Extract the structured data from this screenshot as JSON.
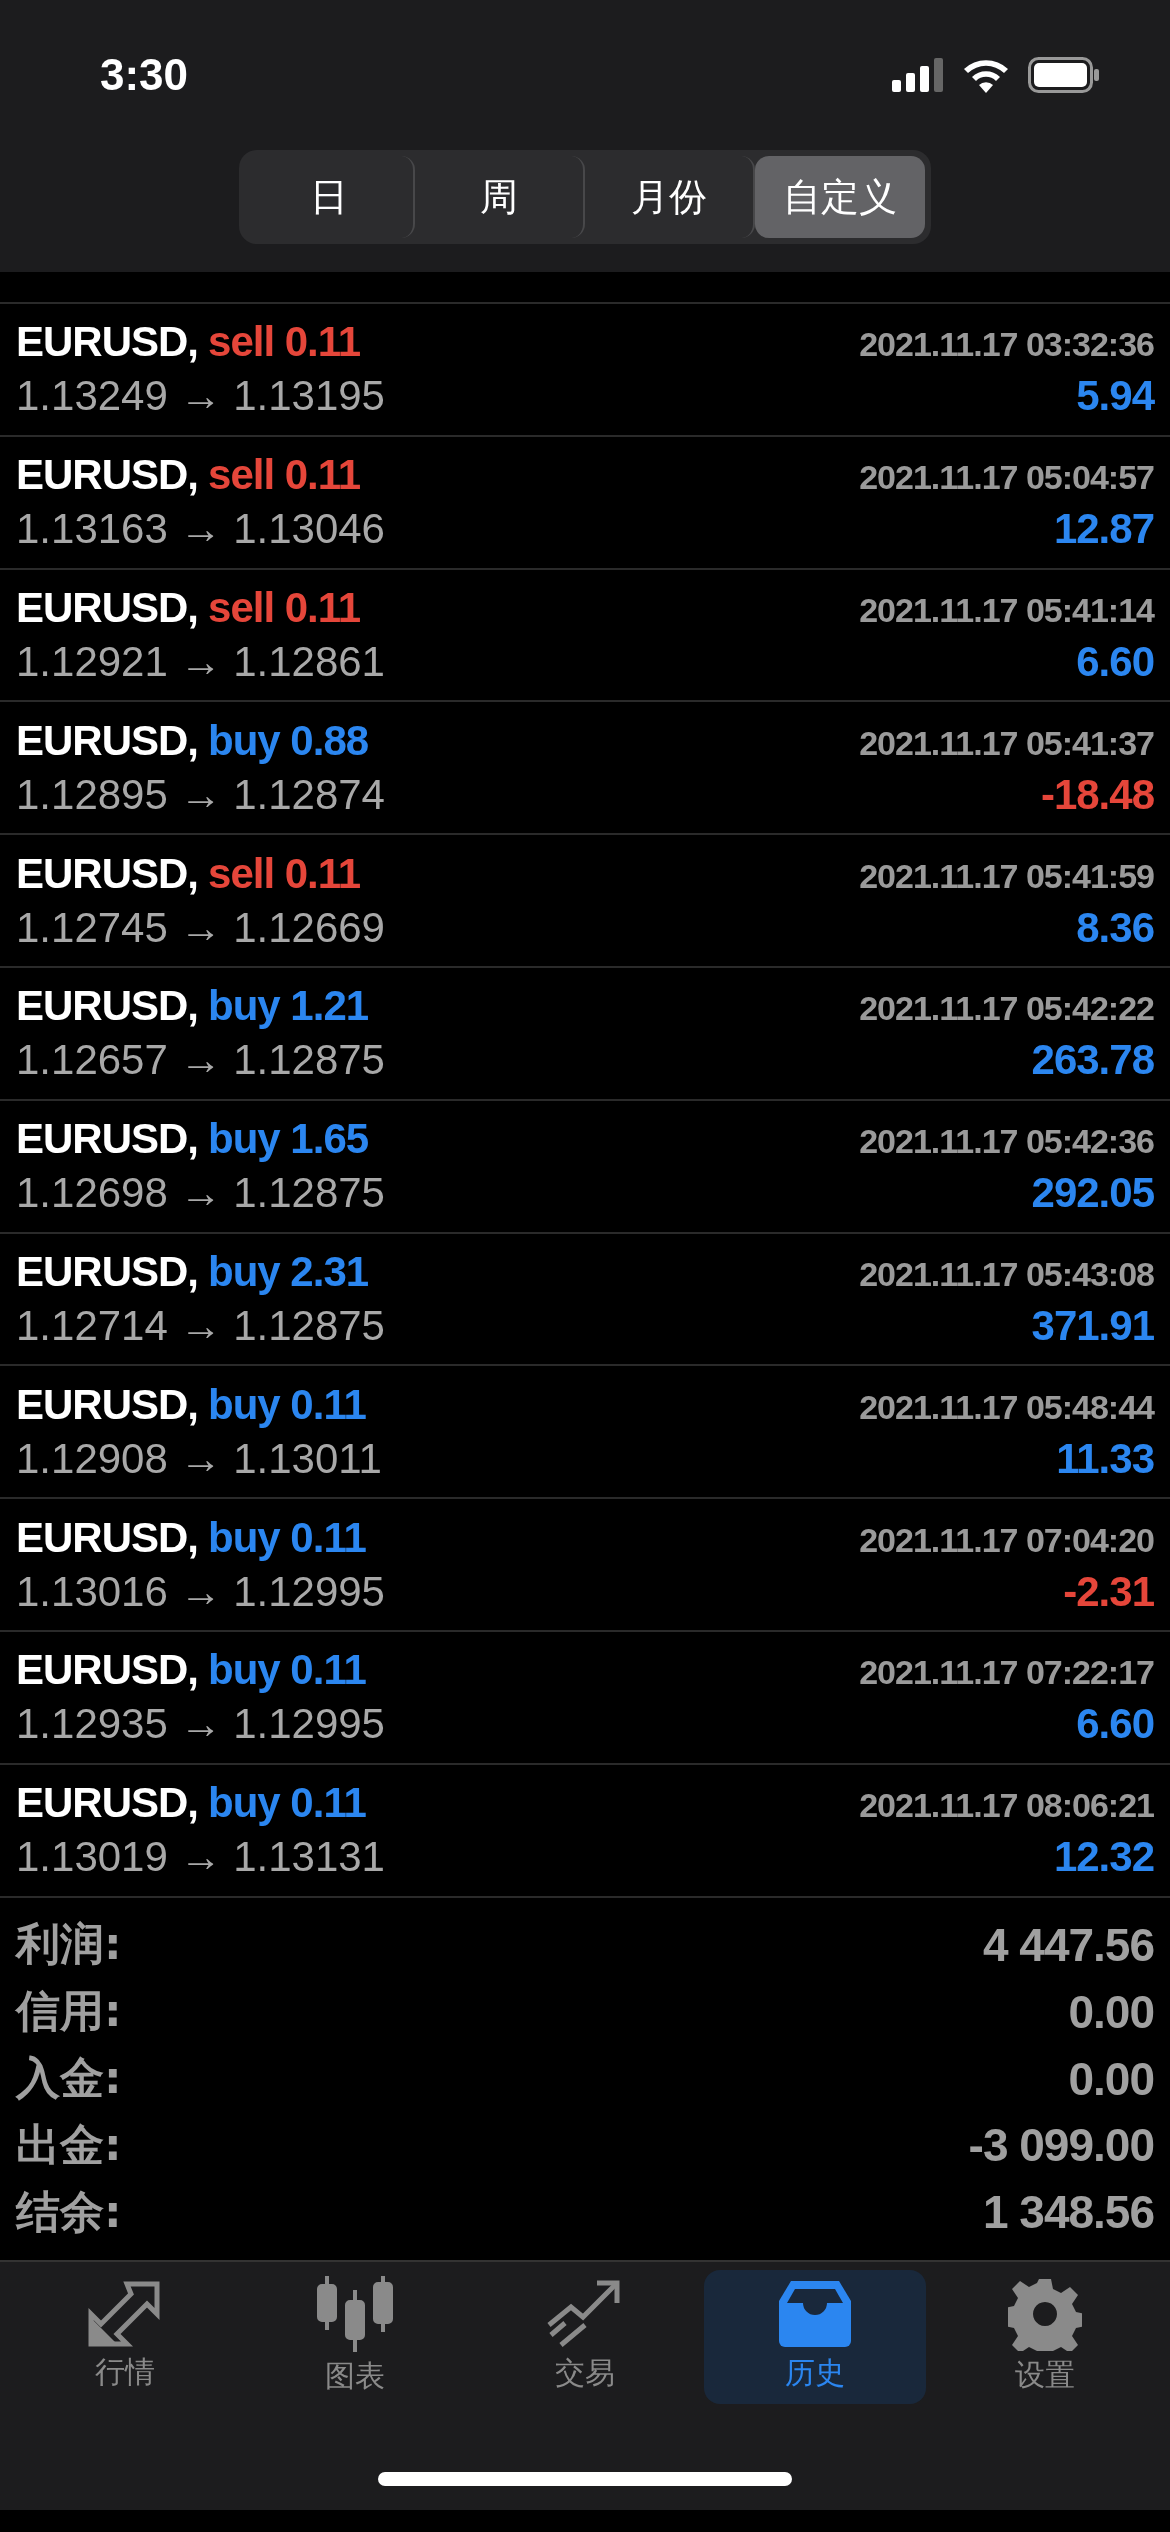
{
  "status_bar": {
    "time": "3:30"
  },
  "period_tabs": [
    {
      "label": "日",
      "selected": false
    },
    {
      "label": "周",
      "selected": false
    },
    {
      "label": "月份",
      "selected": false
    },
    {
      "label": "自定义",
      "selected": true
    }
  ],
  "trades": [
    {
      "symbol": "EURUSD,",
      "order": {
        "text": "sell 0.11",
        "color": "#e5463a"
      },
      "time": "2021.11.17 03:32:36",
      "prices": "1.13249 → 1.13195",
      "profit": {
        "text": "5.94",
        "color": "#2b86f0"
      }
    },
    {
      "symbol": "EURUSD,",
      "order": {
        "text": "sell 0.11",
        "color": "#e5463a"
      },
      "time": "2021.11.17 05:04:57",
      "prices": "1.13163 → 1.13046",
      "profit": {
        "text": "12.87",
        "color": "#2b86f0"
      }
    },
    {
      "symbol": "EURUSD,",
      "order": {
        "text": "sell 0.11",
        "color": "#e5463a"
      },
      "time": "2021.11.17 05:41:14",
      "prices": "1.12921 → 1.12861",
      "profit": {
        "text": "6.60",
        "color": "#2b86f0"
      }
    },
    {
      "symbol": "EURUSD,",
      "order": {
        "text": "buy 0.88",
        "color": "#2b86f0"
      },
      "time": "2021.11.17 05:41:37",
      "prices": "1.12895 → 1.12874",
      "profit": {
        "text": "-18.48",
        "color": "#e5463a"
      }
    },
    {
      "symbol": "EURUSD,",
      "order": {
        "text": "sell 0.11",
        "color": "#e5463a"
      },
      "time": "2021.11.17 05:41:59",
      "prices": "1.12745 → 1.12669",
      "profit": {
        "text": "8.36",
        "color": "#2b86f0"
      }
    },
    {
      "symbol": "EURUSD,",
      "order": {
        "text": "buy 1.21",
        "color": "#2b86f0"
      },
      "time": "2021.11.17 05:42:22",
      "prices": "1.12657 → 1.12875",
      "profit": {
        "text": "263.78",
        "color": "#2b86f0"
      }
    },
    {
      "symbol": "EURUSD,",
      "order": {
        "text": "buy 1.65",
        "color": "#2b86f0"
      },
      "time": "2021.11.17 05:42:36",
      "prices": "1.12698 → 1.12875",
      "profit": {
        "text": "292.05",
        "color": "#2b86f0"
      }
    },
    {
      "symbol": "EURUSD,",
      "order": {
        "text": "buy 2.31",
        "color": "#2b86f0"
      },
      "time": "2021.11.17 05:43:08",
      "prices": "1.12714 → 1.12875",
      "profit": {
        "text": "371.91",
        "color": "#2b86f0"
      }
    },
    {
      "symbol": "EURUSD,",
      "order": {
        "text": "buy 0.11",
        "color": "#2b86f0"
      },
      "time": "2021.11.17 05:48:44",
      "prices": "1.12908 → 1.13011",
      "profit": {
        "text": "11.33",
        "color": "#2b86f0"
      }
    },
    {
      "symbol": "EURUSD,",
      "order": {
        "text": "buy 0.11",
        "color": "#2b86f0"
      },
      "time": "2021.11.17 07:04:20",
      "prices": "1.13016 → 1.12995",
      "profit": {
        "text": "-2.31",
        "color": "#e5463a"
      }
    },
    {
      "symbol": "EURUSD,",
      "order": {
        "text": "buy 0.11",
        "color": "#2b86f0"
      },
      "time": "2021.11.17 07:22:17",
      "prices": "1.12935 → 1.12995",
      "profit": {
        "text": "6.60",
        "color": "#2b86f0"
      }
    },
    {
      "symbol": "EURUSD,",
      "order": {
        "text": "buy 0.11",
        "color": "#2b86f0"
      },
      "time": "2021.11.17 08:06:21",
      "prices": "1.13019 → 1.13131",
      "profit": {
        "text": "12.32",
        "color": "#2b86f0"
      }
    }
  ],
  "summary": [
    {
      "label": "利润:",
      "value": "4 447.56"
    },
    {
      "label": "信用:",
      "value": "0.00"
    },
    {
      "label": "入金:",
      "value": "0.00"
    },
    {
      "label": "出金:",
      "value": "-3 099.00"
    },
    {
      "label": "结余:",
      "value": "1 348.56"
    }
  ],
  "bottom_nav": [
    {
      "label": "行情",
      "kind": "quotes",
      "selected": false
    },
    {
      "label": "图表",
      "kind": "chart",
      "selected": false
    },
    {
      "label": "交易",
      "kind": "trade",
      "selected": false
    },
    {
      "label": "历史",
      "kind": "history",
      "selected": true
    },
    {
      "label": "设置",
      "kind": "settings",
      "selected": false
    }
  ]
}
